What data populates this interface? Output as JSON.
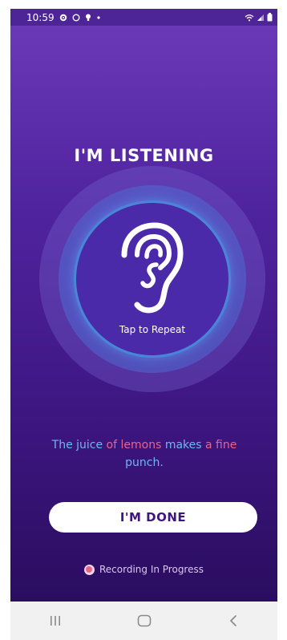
{
  "status_bar": {
    "time": "10:59",
    "icons": [
      "gear-icon",
      "circle-icon",
      "bulb-icon",
      "dot-icon"
    ],
    "right_icons": [
      "wifi-icon",
      "signal-icon",
      "battery-icon"
    ]
  },
  "screen": {
    "title": "I'M LISTENING",
    "tap_label": "Tap to Repeat",
    "sentence_parts": [
      {
        "text": "The juice ",
        "color": "#6fb6f2"
      },
      {
        "text": "of lemons",
        "color": "#e8638f"
      },
      {
        "text": " makes ",
        "color": "#6fb6f2"
      },
      {
        "text": "a fine",
        "color": "#e8638f"
      },
      {
        "text": " punch.",
        "color": "#6fb6f2"
      }
    ],
    "done_button_label": "I'M DONE",
    "recording_status": "Recording In Progress"
  },
  "nav_bar": {
    "buttons": [
      "recents-icon",
      "home-icon",
      "back-icon"
    ]
  },
  "colors": {
    "accent_pink": "#e8638f",
    "accent_blue": "#6fb6f2",
    "primary_purple": "#4e2596"
  }
}
